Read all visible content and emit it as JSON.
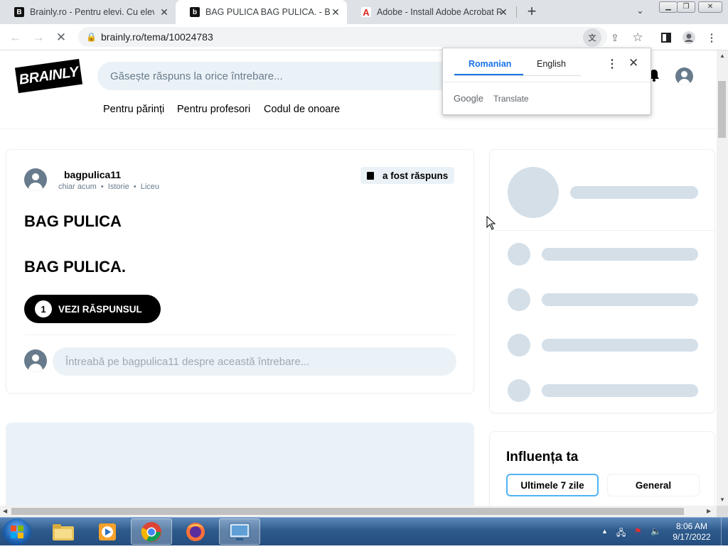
{
  "browser": {
    "tabs": [
      {
        "title": "Brainly.ro - Pentru elevi. Cu elevi.",
        "favicon": "B",
        "active": false
      },
      {
        "title": "BAG PULICA BAG PULICA. - Brainly",
        "favicon": "b",
        "active": true
      },
      {
        "title": "Adobe - Install Adobe Acrobat Re",
        "favicon": "A",
        "active": false
      }
    ],
    "new_tab": "+",
    "url": "brainly.ro/tema/10024783"
  },
  "header": {
    "logo": "BRAINLY",
    "search_placeholder": "Găsește răspuns la orice întrebare...",
    "nav": [
      "Pentru părinți",
      "Pentru profesori",
      "Codul de onoare"
    ]
  },
  "question": {
    "username": "bagpulica11",
    "time": "chiar acum",
    "subject": "Istorie",
    "level": "Liceu",
    "separator": "•",
    "badge": "a fost răspuns",
    "lines": [
      "BAG PULICA",
      "BAG PULICA."
    ],
    "answer_count": "1",
    "see_answer": "VEZI RĂSPUNSUL",
    "ask_placeholder": "Întreabă pe bagpulica11 despre această întrebare..."
  },
  "translate_popup": {
    "tabs": [
      "Romanian",
      "English"
    ],
    "selected": "Romanian",
    "brand_google": "Google",
    "brand_translate": "Translate"
  },
  "influence": {
    "title": "Influența ta",
    "tabs": [
      "Ultimele 7 zile",
      "General"
    ],
    "selected": "Ultimele 7 zile"
  },
  "taskbar": {
    "time": "8:06 AM",
    "date": "9/17/2022"
  },
  "colors": {
    "brand_black": "#000000",
    "skeleton": "#d4dfe8",
    "input_bg": "#ebf2f7",
    "link_blue": "#1a73e8"
  }
}
